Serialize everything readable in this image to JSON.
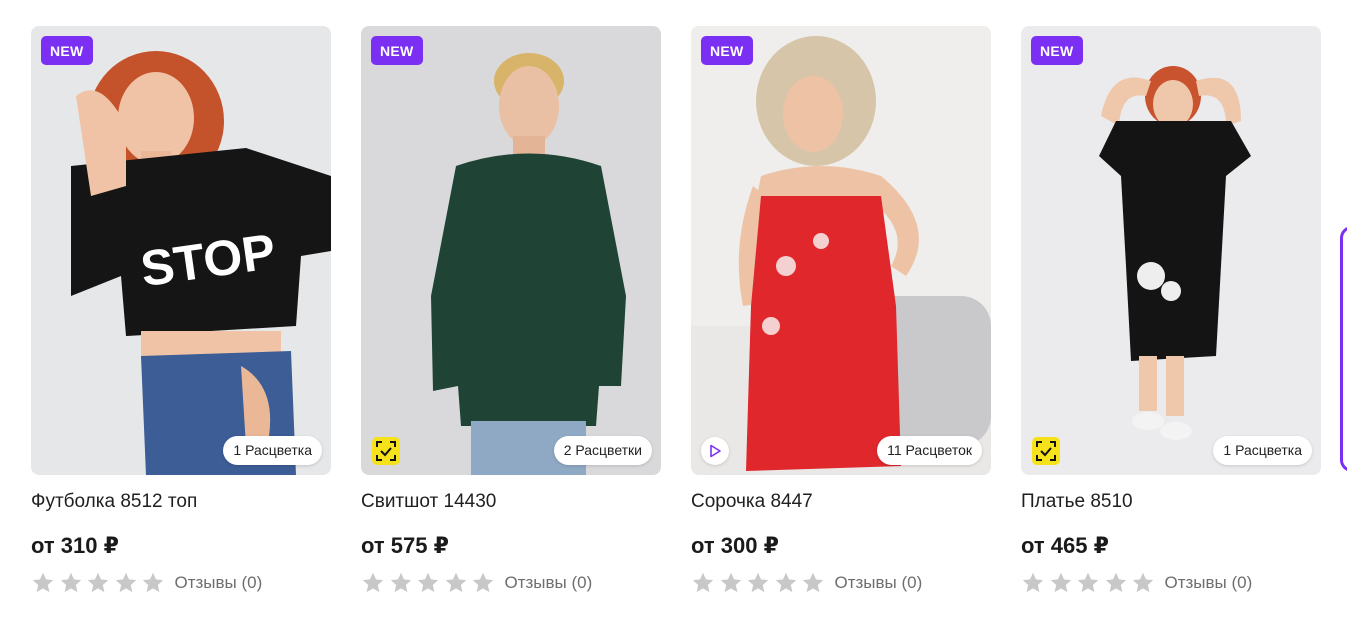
{
  "products": [
    {
      "badge": "NEW",
      "colors": "1 Расцветка",
      "title": "Футболка 8512 топ",
      "price": "от 310 ₽",
      "reviews": "Отзывы (0)",
      "overlay_icon": null
    },
    {
      "badge": "NEW",
      "colors": "2 Расцветки",
      "title": "Свитшот 14430",
      "price": "от 575 ₽",
      "reviews": "Отзывы (0)",
      "overlay_icon": "fit-check-icon"
    },
    {
      "badge": "NEW",
      "colors": "11 Расцветок",
      "title": "Сорочка 8447",
      "price": "от 300 ₽",
      "reviews": "Отзывы (0)",
      "overlay_icon": "play-video-icon"
    },
    {
      "badge": "NEW",
      "colors": "1 Расцветка",
      "title": "Платье 8510",
      "price": "от 465 ₽",
      "reviews": "Отзывы (0)",
      "overlay_icon": "fit-check-icon"
    }
  ],
  "rating_stars": 5,
  "colors": {
    "accent": "#7b2ff2",
    "fit_badge": "#f5e21a",
    "star_empty": "#c8c8c8"
  }
}
